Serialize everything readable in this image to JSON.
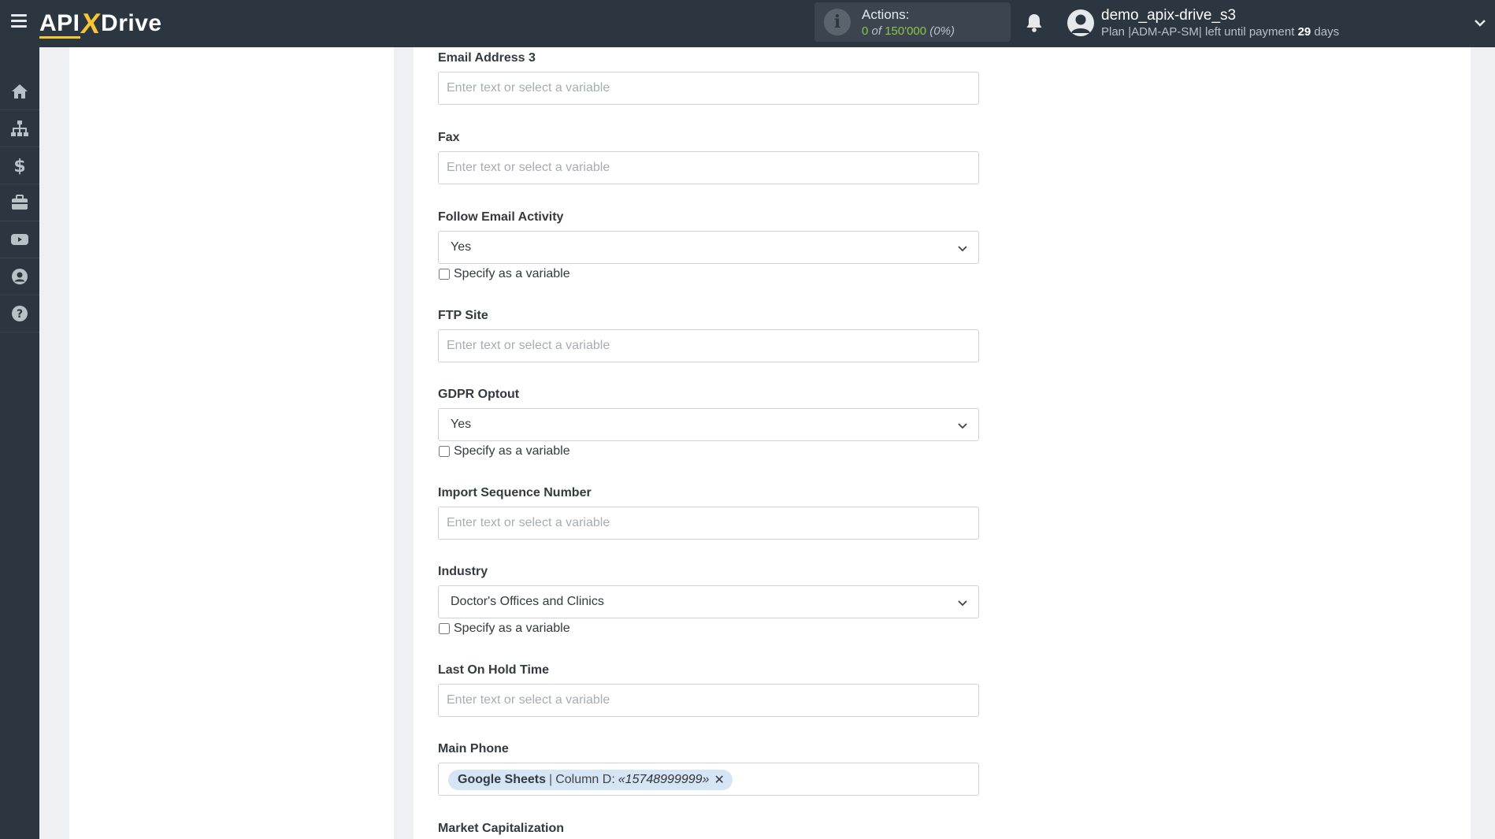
{
  "header": {
    "logo_left": "API",
    "logo_x": "X",
    "logo_right": "Drive",
    "actions_label": "Actions:",
    "actions_used": "0",
    "actions_of": "of",
    "actions_total": "150'000",
    "actions_percent": "(0%)",
    "user_name": "demo_apix-drive_s3",
    "plan_prefix": "Plan |ADM-AP-SM| left until payment",
    "plan_days": "29",
    "plan_suffix": "days"
  },
  "sidebar": {
    "items": [
      "home-icon",
      "sitemap-icon",
      "dollar-icon",
      "briefcase-icon",
      "youtube-icon",
      "user-icon",
      "help-icon"
    ]
  },
  "form": {
    "placeholder": "Enter text or select a variable",
    "specify_label": "Specify as a variable",
    "fields": {
      "email3": {
        "label": "Email Address 3"
      },
      "fax": {
        "label": "Fax"
      },
      "follow_email": {
        "label": "Follow Email Activity",
        "value": "Yes"
      },
      "ftp": {
        "label": "FTP Site"
      },
      "gdpr": {
        "label": "GDPR Optout",
        "value": "Yes"
      },
      "import_seq": {
        "label": "Import Sequence Number"
      },
      "industry": {
        "label": "Industry",
        "value": "Doctor's Offices and Clinics"
      },
      "last_hold": {
        "label": "Last On Hold Time"
      },
      "main_phone": {
        "label": "Main Phone",
        "tag_source": "Google Sheets",
        "tag_sep": "|",
        "tag_column": "Column D:",
        "tag_value": "«15748999999»",
        "tag_remove": "✕"
      },
      "market_cap": {
        "label": "Market Capitalization"
      }
    }
  }
}
